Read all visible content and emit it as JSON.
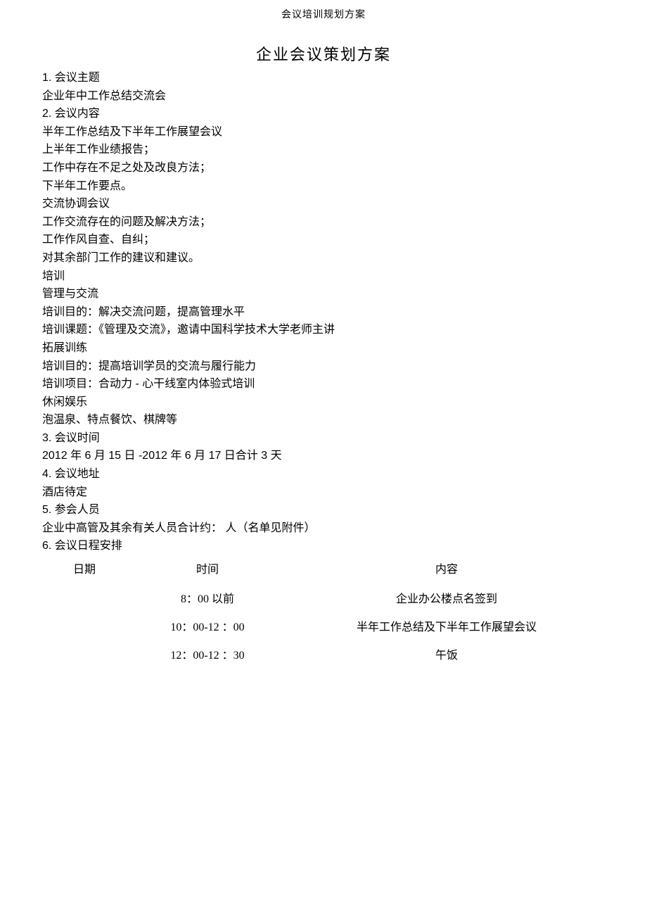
{
  "header": "会议培训规划方案",
  "title": "企业会议策划方案",
  "sect1": {
    "heading": "1. 会议主题",
    "l0": "企业年中工作总结交流会"
  },
  "sect2": {
    "heading": "2. 会议内容",
    "l0": "半年工作总结及下半年工作展望会议",
    "l1": "上半年工作业绩报告；",
    "l2": "工作中存在不足之处及改良方法；",
    "l3": "下半年工作要点。",
    "l4": "交流协调会议",
    "l5": "工作交流存在的问题及解决方法；",
    "l6": "工作作风自查、自纠；",
    "l7": "对其余部门工作的建议和建议。",
    "l8": "培训",
    "l9": "管理与交流",
    "l10": "培训目的：解决交流问题，提高管理水平",
    "l11": "培训课题：《管理及交流》，邀请中国科学技术大学老师主讲",
    "l12": "拓展训练",
    "l13": "培训目的：提高培训学员的交流与履行能力",
    "l14": "培训项目：合动力 - 心干线室内体验式培训",
    "l15": "休闲娱乐",
    "l16": "泡温泉、特点餐饮、棋牌等"
  },
  "sect3": {
    "heading": "3. 会议时间",
    "l0": "2012 年 6 月 15 日 -2012 年 6 月 17 日合计 3 天"
  },
  "sect4": {
    "heading": "4. 会议地址",
    "l0": "酒店待定"
  },
  "sect5": {
    "heading": "5. 参会人员",
    "l0": "企业中高管及其余有关人员合计约：            人（名单见附件）"
  },
  "sect6": {
    "heading": "6. 会议日程安排"
  },
  "schedule": {
    "headers": {
      "c0": "日期",
      "c1": "时间",
      "c2": "内容"
    },
    "rows": [
      {
        "date": "",
        "time": "8：00 以前",
        "content": "企业办公楼点名签到"
      },
      {
        "date": "",
        "time": "10：00-12 ：00",
        "content": "半年工作总结及下半年工作展望会议"
      },
      {
        "date": "",
        "time": "12：00-12 ：30",
        "content": "午饭"
      }
    ]
  }
}
